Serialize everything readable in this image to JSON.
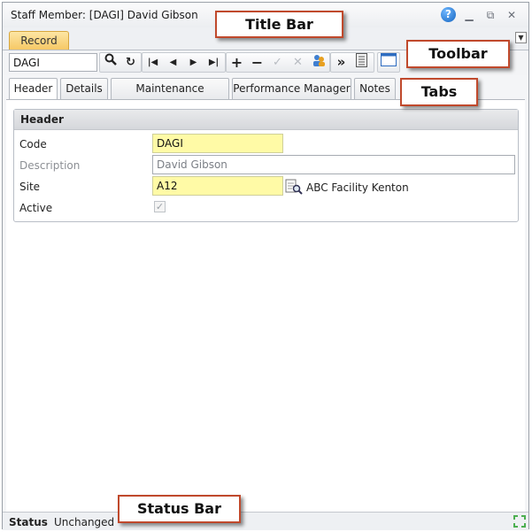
{
  "window": {
    "title": "Staff Member: [DAGI] David Gibson"
  },
  "ribbon": {
    "tab_label": "Record"
  },
  "toolbar": {
    "search_value": "DAGI"
  },
  "tabs": [
    {
      "label": "Header"
    },
    {
      "label": "Details"
    },
    {
      "label": "Maintenance Manager"
    },
    {
      "label": "Performance Manager"
    },
    {
      "label": "Notes"
    }
  ],
  "header_group": {
    "title": "Header",
    "fields": {
      "code": {
        "label": "Code",
        "value": "DAGI"
      },
      "description": {
        "label": "Description",
        "value": "David Gibson"
      },
      "site": {
        "label": "Site",
        "value": "A12",
        "name": "ABC Facility Kenton"
      },
      "active": {
        "label": "Active",
        "checked": true
      }
    }
  },
  "status": {
    "label": "Status",
    "value": "Unchanged"
  },
  "callouts": {
    "title_bar": "Title Bar",
    "toolbar": "Toolbar",
    "tabs": "Tabs",
    "status_bar": "Status Bar"
  },
  "icons": [
    "help-icon",
    "minimize-icon",
    "restore-icon",
    "close-icon",
    "search-icon",
    "refresh-icon",
    "first-record-icon",
    "previous-record-icon",
    "next-record-icon",
    "last-record-icon",
    "add-icon",
    "delete-icon",
    "save-icon",
    "cancel-icon",
    "users-icon",
    "more-icon",
    "list-icon",
    "window-icon",
    "lookup-icon",
    "resize-icon"
  ],
  "colors": {
    "required_field": "#fffaa6",
    "ribbon_tab": "#f6c865",
    "callout_border": "#c0492c"
  }
}
